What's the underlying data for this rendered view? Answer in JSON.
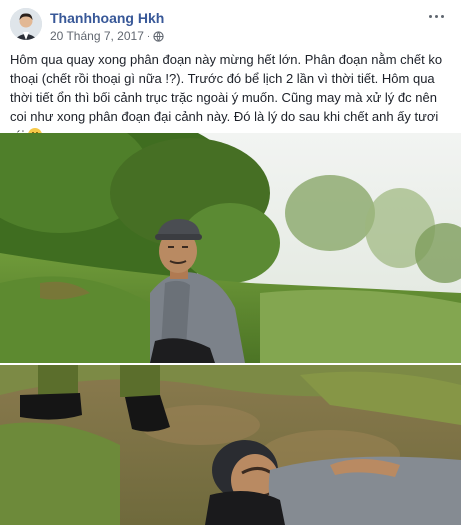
{
  "post": {
    "author": "Thanhhoang Hkh",
    "date": "20 Tháng 7, 2017",
    "separator": "·",
    "privacy_icon": "globe-icon",
    "more_icon": "more-dots-icon",
    "text": "Hôm qua quay xong phân đoạn này mừng hết lớn. Phân đoạn nằm chết ko thoại (chết rồi thoại gì nữa !?). Trước đó bể lịch 2 lần vì thời tiết. Hôm qua thời tiết ổn thì bối cảnh trục trặc ngoài ý muốn. Cũng may mà xử lý đc nên coi như xong phân đoạn đại cảnh này. Đó là lý do sau khi chết anh ấy tươi rói",
    "emoji": "smile-emoji"
  },
  "colors": {
    "author_link": "#385898",
    "meta_text": "#616770",
    "body_text": "#1d2129"
  }
}
